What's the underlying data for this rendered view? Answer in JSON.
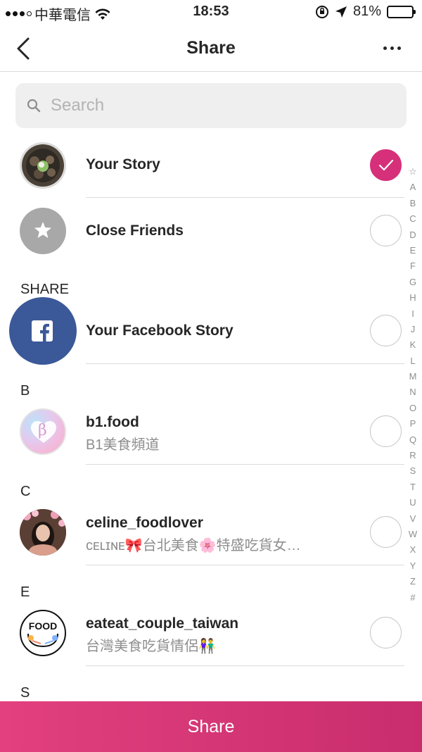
{
  "status_bar": {
    "carrier": "中華電信",
    "time": "18:53",
    "battery_percent": "81%",
    "battery_level": 0.81
  },
  "nav": {
    "title": "Share"
  },
  "search": {
    "placeholder": "Search"
  },
  "top_items": [
    {
      "title": "Your Story",
      "checked": true
    },
    {
      "title": "Close Friends",
      "checked": false
    }
  ],
  "share_section": {
    "label": "SHARE",
    "item": {
      "title": "Your Facebook Story",
      "checked": false
    }
  },
  "sections": [
    {
      "letter": "B",
      "items": [
        {
          "username": "b1.food",
          "subtitle": "B1美食頻道"
        }
      ]
    },
    {
      "letter": "C",
      "items": [
        {
          "username": "celine_foodlover",
          "subtitle": "ᴄᴇʟɪɴᴇ🎀台北美食🌸特盛吃貨女…"
        }
      ]
    },
    {
      "letter": "E",
      "items": [
        {
          "username": "eateat_couple_taiwan",
          "subtitle": "台灣美食吃貨情侶👫"
        }
      ]
    },
    {
      "letter": "S",
      "items": []
    }
  ],
  "avatars": {
    "b1_food_text": "β",
    "eateat_logo_text": "FOOD"
  },
  "index_letters": [
    "☆",
    "A",
    "B",
    "C",
    "D",
    "E",
    "F",
    "G",
    "H",
    "I",
    "J",
    "K",
    "L",
    "M",
    "N",
    "O",
    "P",
    "Q",
    "R",
    "S",
    "T",
    "U",
    "V",
    "W",
    "X",
    "Y",
    "Z",
    "#"
  ],
  "share_button": "Share",
  "colors": {
    "accent": "#d6307a",
    "facebook": "#3b5998",
    "close_friends_gray": "#a8a8a8"
  }
}
